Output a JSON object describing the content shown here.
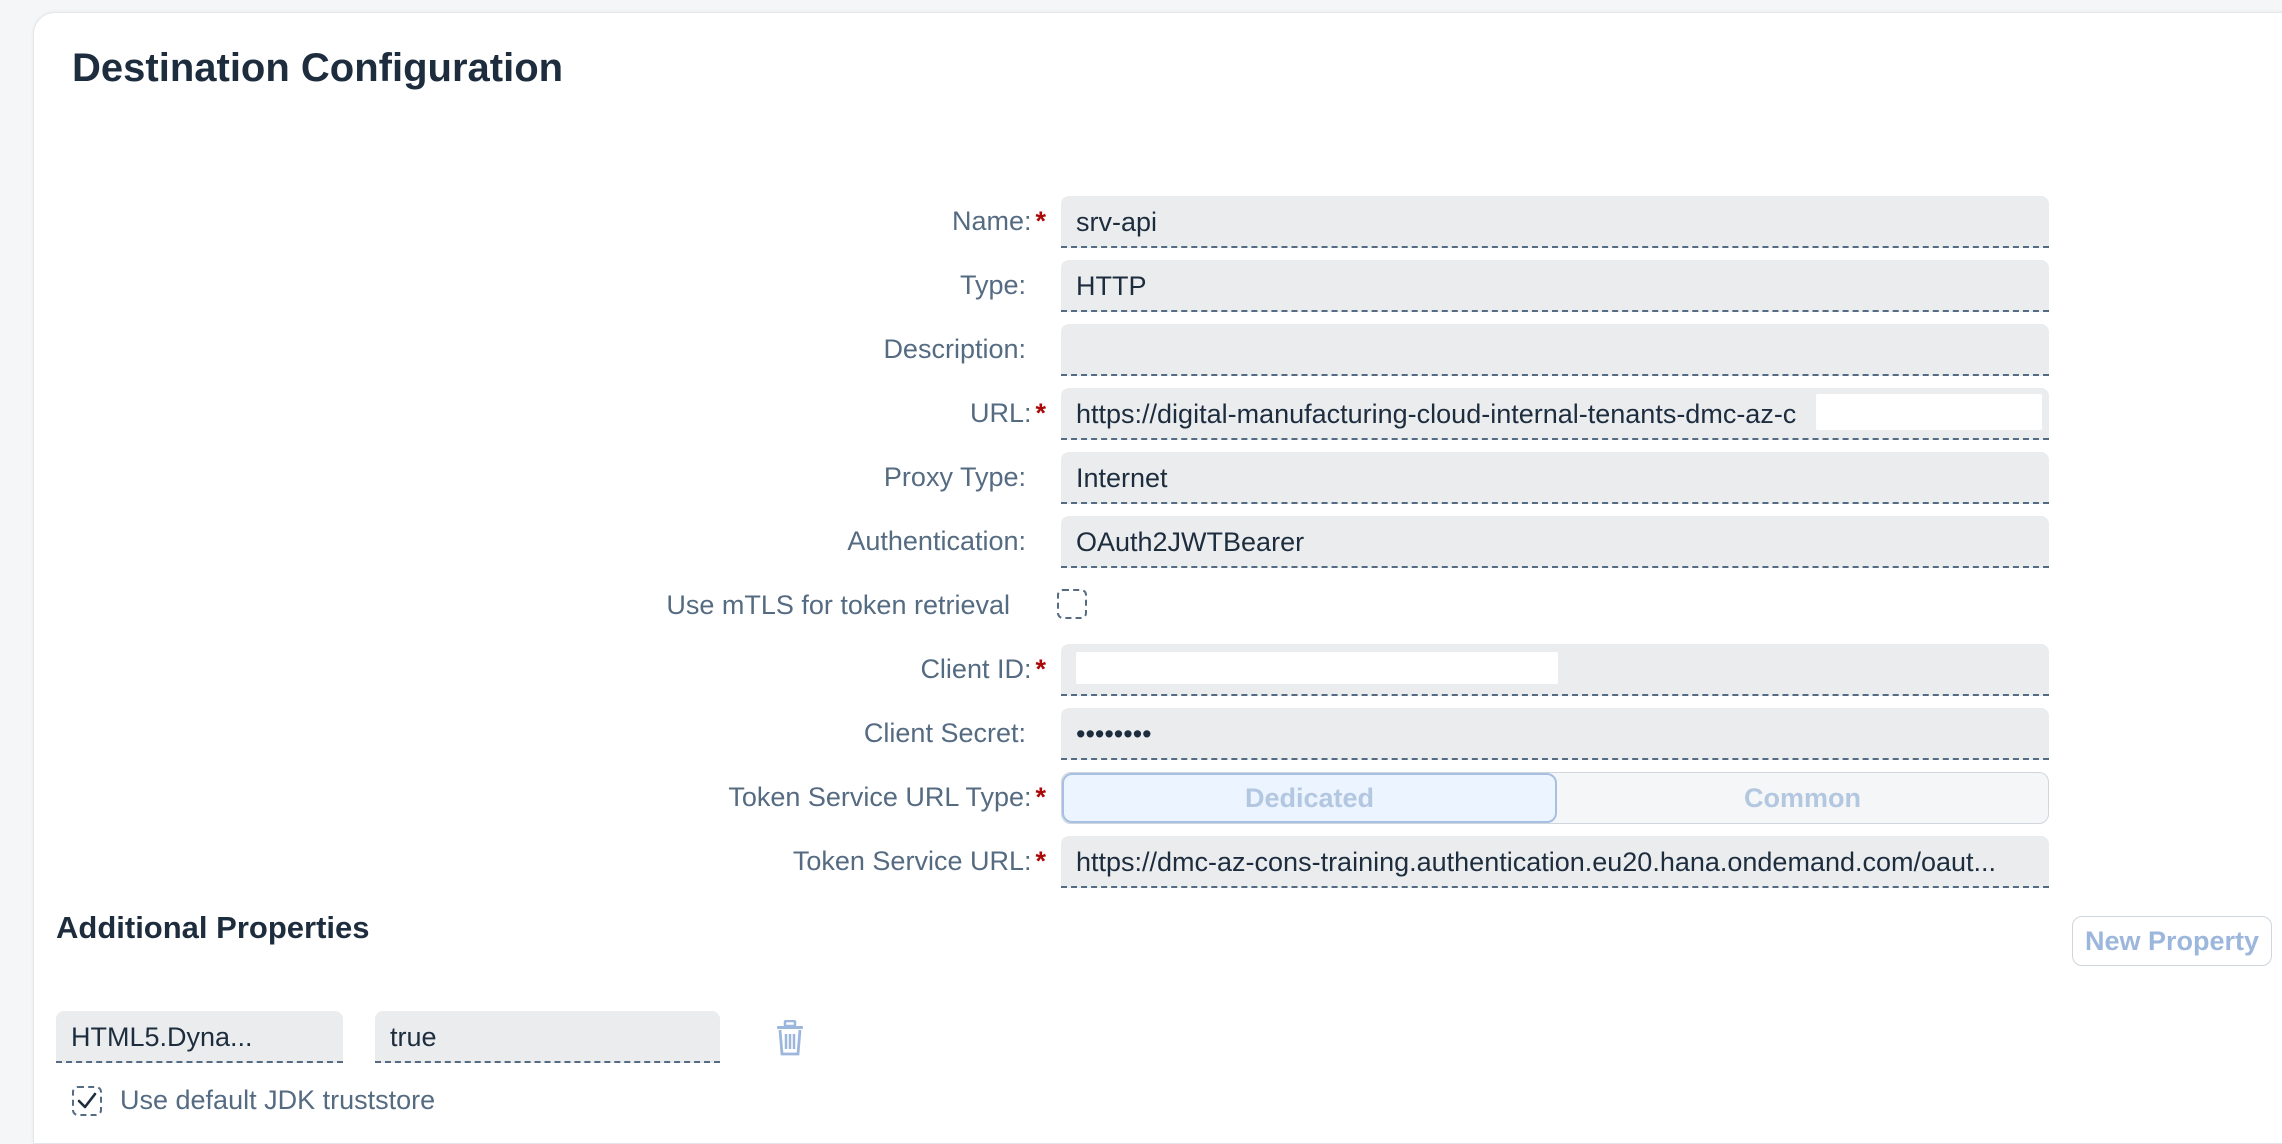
{
  "page": {
    "title": "Destination Configuration"
  },
  "form": {
    "name": {
      "label": "Name:",
      "required": "*",
      "value": "srv-api"
    },
    "type": {
      "label": "Type:",
      "value": "HTTP"
    },
    "description": {
      "label": "Description:",
      "value": ""
    },
    "url": {
      "label": "URL:",
      "required": "*",
      "value": "https://digital-manufacturing-cloud-internal-tenants-dmc-az-c"
    },
    "proxy_type": {
      "label": "Proxy Type:",
      "value": "Internet"
    },
    "authentication": {
      "label": "Authentication:",
      "value": "OAuth2JWTBearer"
    },
    "use_mtls": {
      "label": "Use mTLS for token retrieval",
      "checked": false
    },
    "client_id": {
      "label": "Client ID:",
      "required": "*",
      "value": ""
    },
    "client_secret": {
      "label": "Client Secret:",
      "value": "••••••••"
    },
    "token_service_url_type": {
      "label": "Token Service URL Type:",
      "required": "*",
      "options": [
        "Dedicated",
        "Common"
      ],
      "selected": "Dedicated"
    },
    "token_service_url": {
      "label": "Token Service URL:",
      "required": "*",
      "value": "https://dmc-az-cons-training.authentication.eu20.hana.ondemand.com/oaut..."
    }
  },
  "additional_properties": {
    "title": "Additional Properties",
    "new_property_label": "New Property",
    "rows": [
      {
        "key": "HTML5.Dyna...",
        "value": "true",
        "delete_icon": "trash-icon"
      }
    ]
  },
  "truststore": {
    "label": "Use default JDK truststore",
    "checked": true
  },
  "colors": {
    "required": "#aa0808",
    "label": "#556b82",
    "text": "#1d2d3e",
    "field_bg": "#eaecee",
    "disabled_accent": "#b3c7e0"
  }
}
